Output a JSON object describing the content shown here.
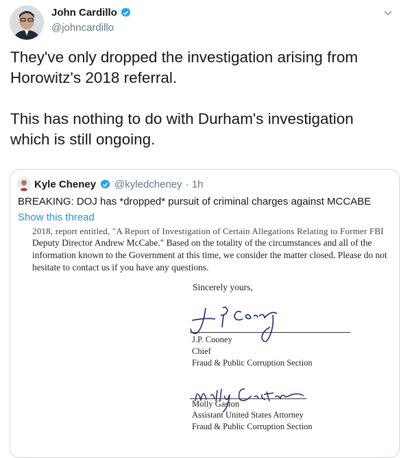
{
  "author": {
    "name": "John Cardillo",
    "handle": "@johncardillo",
    "verified_color": "#1da1f2"
  },
  "tweet": {
    "paragraphs": [
      "They've only dropped the investigation arising from Horowitz's 2018 referral.",
      "This has nothing to do with Durham's investigation which is still ongoing."
    ]
  },
  "quoted": {
    "name": "Kyle Cheney",
    "handle": "@kyledcheney",
    "time": "· 1h",
    "text": "BREAKING: DOJ has *dropped* pursuit of criminal charges against MCCABE",
    "show_thread": "Show this thread"
  },
  "document": {
    "line0": "2018, report entitled, \"A Report of Investigation of Certain Allegations Relating to Former FBI",
    "line1": "Deputy Director Andrew McCabe.\" Based on the totality of the circumstances and all of the",
    "line2": "information known to the Government at this time, we consider the matter closed. Please do not",
    "line3": "hesitate to contact us if you have any questions.",
    "closing": "Sincerely yours,",
    "signer1_name": "J.P. Cooney",
    "signer1_title": "Chief",
    "signer1_section": "Fraud & Public Corruption Section",
    "signer2_name": "Molly Gaston",
    "signer2_title": "Assistant United States Attorney",
    "signer2_section": "Fraud & Public Corruption Section"
  },
  "icons": {
    "verified": "verified-badge-icon",
    "chevron": "chevron-down-icon"
  }
}
